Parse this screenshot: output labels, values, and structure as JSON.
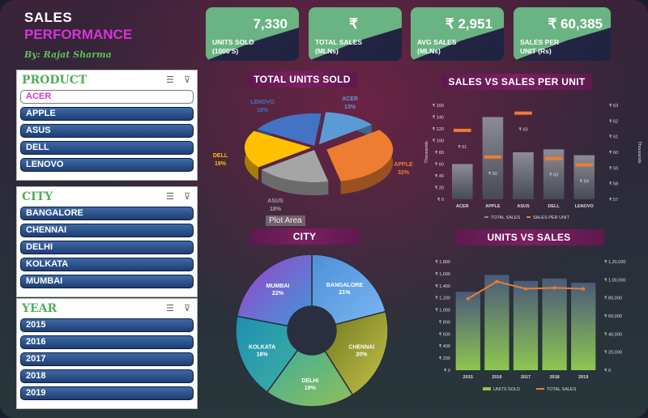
{
  "header": {
    "title_line1": "SALES",
    "title_line2": "PERFORMANCE",
    "byline": "By: Rajat Sharma"
  },
  "kpis": [
    {
      "value": "7,330",
      "label_line1": "UNITS SOLD",
      "label_line2": "(1000'S)"
    },
    {
      "value": "₹",
      "label_line1": "TOTAL SALES",
      "label_line2": "(MLNs)"
    },
    {
      "value": "₹ 2,951",
      "label_line1": "AVG SALES",
      "label_line2": "(MLNs)"
    },
    {
      "value": "₹ 60,385",
      "label_line1": "SALES PER",
      "label_line2": "UNIT (Rs)"
    }
  ],
  "slicers": {
    "product": {
      "title": "PRODUCT",
      "items": [
        "ACER",
        "APPLE",
        "ASUS",
        "DELL",
        "LENOVO"
      ],
      "selected": "ACER"
    },
    "city": {
      "title": "CITY",
      "items": [
        "BANGALORE",
        "CHENNAI",
        "DELHI",
        "KOLKATA",
        "MUMBAI"
      ]
    },
    "year": {
      "title": "YEAR",
      "items": [
        "2015",
        "2016",
        "2017",
        "2018",
        "2019"
      ]
    }
  },
  "icons": {
    "multi_select": "multi-select-icon",
    "clear_filter": "clear-filter-icon"
  },
  "chart_titles": {
    "units_sold": "TOTAL UNITS SOLD",
    "sales_vs_per_unit": "SALES VS SALES PER UNIT",
    "city": "CITY",
    "units_vs_sales": "UNITS VS SALES"
  },
  "tooltip": "Plot Area",
  "chart_data": [
    {
      "type": "pie",
      "title": "TOTAL UNITS SOLD",
      "categories": [
        "ACER",
        "APPLE",
        "ASUS",
        "DELL",
        "LENOVO"
      ],
      "values": [
        13,
        32,
        18,
        19,
        18
      ],
      "unit": "%",
      "colors": [
        "#5b9bd5",
        "#ed7d31",
        "#a5a5a5",
        "#ffc000",
        "#4472c4"
      ]
    },
    {
      "type": "bar",
      "title": "SALES VS SALES PER UNIT",
      "categories": [
        "ACER",
        "APPLE",
        "ASUS",
        "DELL",
        "LENOVO"
      ],
      "series": [
        {
          "name": "TOTAL SALES",
          "values": [
            60,
            140,
            80,
            85,
            75
          ],
          "axis": "left"
        },
        {
          "name": "SALES PER UNIT",
          "values": [
            61.4,
            59.7,
            62.5,
            59.6,
            59.2
          ],
          "axis": "right"
        }
      ],
      "bar_labels": [
        "₹ 61",
        "₹ 60",
        "₹ 63",
        "₹ 60",
        "₹ 59"
      ],
      "y_left_label": "Thousands",
      "y_right_label": "Thousands",
      "y_left_ticks": [
        "₹ 0",
        "₹ 20",
        "₹ 40",
        "₹ 60",
        "₹ 80",
        "₹ 100",
        "₹ 120",
        "₹ 140",
        "₹ 160"
      ],
      "y_right_ticks": [
        "₹ 57",
        "₹ 58",
        "₹ 59",
        "₹ 60",
        "₹ 61",
        "₹ 62",
        "₹ 63"
      ],
      "ylim_left": [
        0,
        160
      ],
      "ylim_right": [
        57,
        63
      ]
    },
    {
      "type": "pie",
      "subtype": "doughnut",
      "title": "CITY",
      "categories": [
        "BANGALORE",
        "CHENNAI",
        "DELHI",
        "KOLKATA",
        "MUMBAI"
      ],
      "values": [
        21,
        20,
        19,
        18,
        22
      ],
      "unit": "%"
    },
    {
      "type": "bar",
      "title": "UNITS VS SALES",
      "categories": [
        "2015",
        "2016",
        "2017",
        "2018",
        "2019"
      ],
      "series": [
        {
          "name": "UNITS SOLD",
          "values": [
            1300,
            1580,
            1480,
            1520,
            1450
          ],
          "axis": "left"
        },
        {
          "name": "TOTAL SALES",
          "values": [
            79000,
            98000,
            90000,
            91000,
            90000
          ],
          "axis": "right"
        }
      ],
      "y_left_ticks": [
        "₹ 0",
        "₹ 200",
        "₹ 400",
        "₹ 600",
        "₹ 800",
        "₹ 1,000",
        "₹ 1,200",
        "₹ 1,400",
        "₹ 1,600",
        "₹ 1,800"
      ],
      "y_right_ticks": [
        "₹ 0",
        "₹ 20,000",
        "₹ 40,000",
        "₹ 60,000",
        "₹ 80,000",
        "₹ 1,00,000",
        "₹ 1,20,000"
      ],
      "ylim_left": [
        0,
        1800
      ],
      "ylim_right": [
        0,
        120000
      ]
    }
  ]
}
